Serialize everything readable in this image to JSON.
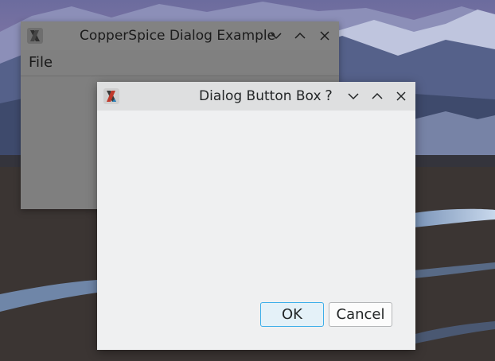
{
  "main_window": {
    "title": "CopperSpice Dialog Example",
    "menu": {
      "file_label": "File"
    },
    "title_buttons": [
      "minimize-icon",
      "maximize-icon",
      "close-icon"
    ]
  },
  "dialog": {
    "title": "Dialog Button Box",
    "help_label": "?",
    "title_buttons": [
      "help-icon",
      "minimize-icon",
      "maximize-icon",
      "close-icon"
    ],
    "ok_label": "OK",
    "cancel_label": "Cancel"
  },
  "colors": {
    "focus_accent": "#3daee9",
    "dialog_background": "#eff0f1",
    "dimmed_window": "#7f7f7f"
  }
}
